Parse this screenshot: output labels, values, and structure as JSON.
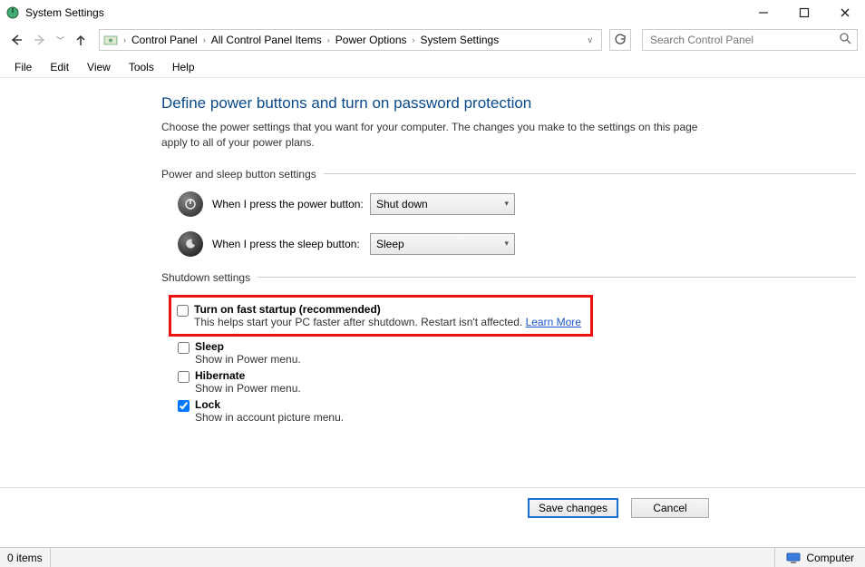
{
  "window": {
    "title": "System Settings"
  },
  "breadcrumbs": {
    "items": [
      "Control Panel",
      "All Control Panel Items",
      "Power Options",
      "System Settings"
    ]
  },
  "search": {
    "placeholder": "Search Control Panel"
  },
  "menubar": {
    "items": [
      "File",
      "Edit",
      "View",
      "Tools",
      "Help"
    ]
  },
  "page": {
    "title": "Define power buttons and turn on password protection",
    "description": "Choose the power settings that you want for your computer. The changes you make to the settings on this page apply to all of your power plans."
  },
  "section_buttons": {
    "header": "Power and sleep button settings",
    "power_label": "When I press the power button:",
    "power_value": "Shut down",
    "sleep_label": "When I press the sleep button:",
    "sleep_value": "Sleep"
  },
  "section_shutdown": {
    "header": "Shutdown settings",
    "fast_startup": {
      "title": "Turn on fast startup (recommended)",
      "desc": "This helps start your PC faster after shutdown. Restart isn't affected. ",
      "link": "Learn More",
      "checked": false
    },
    "sleep": {
      "title": "Sleep",
      "desc": "Show in Power menu.",
      "checked": false
    },
    "hibernate": {
      "title": "Hibernate",
      "desc": "Show in Power menu.",
      "checked": false
    },
    "lock": {
      "title": "Lock",
      "desc": "Show in account picture menu.",
      "checked": true
    }
  },
  "buttons": {
    "save": "Save changes",
    "cancel": "Cancel"
  },
  "statusbar": {
    "items": "0 items",
    "computer": "Computer"
  }
}
